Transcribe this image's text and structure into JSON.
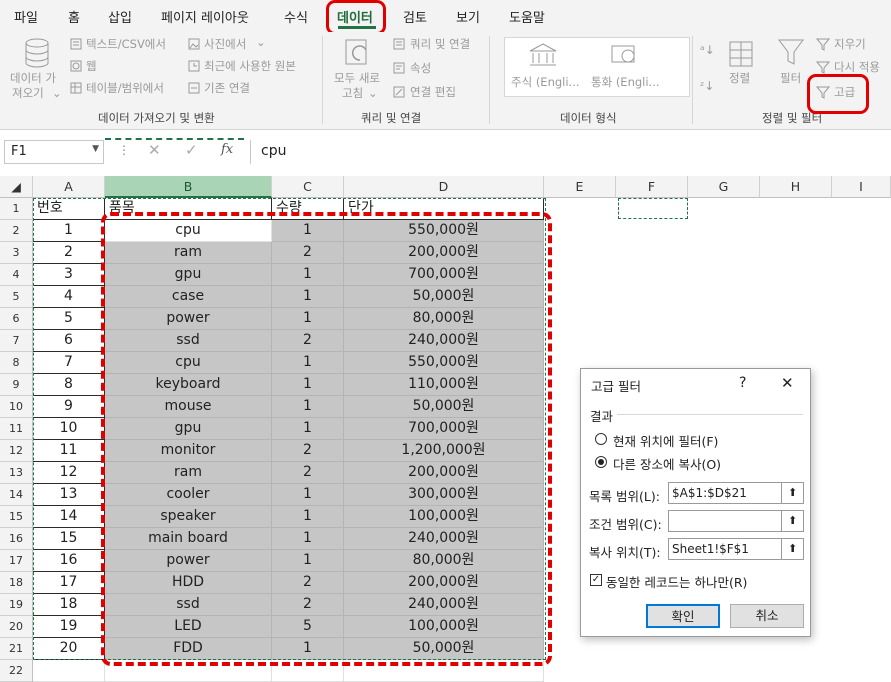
{
  "tabs": [
    "파일",
    "홈",
    "삽입",
    "페이지 레이아웃",
    "수식",
    "데이터",
    "검토",
    "보기",
    "도움말"
  ],
  "ribbon": {
    "get_data": [
      "데이터 가",
      "져오기"
    ],
    "text_csv": "텍스트/CSV에서",
    "web": "웹",
    "table_range": "테이블/범위에서",
    "from_picture": "사진에서",
    "recent_sources": "최근에 사용한 원본",
    "existing_conn": "기존 연결",
    "group_get": "데이터 가져오기 및 변환",
    "refresh_all": [
      "모두 새로",
      "고침"
    ],
    "queries_conn": "쿼리 및 연결",
    "properties": "속성",
    "edit_links": "연결 편집",
    "group_queries": "쿼리 및 연결",
    "stocks": "주식 (Engli...",
    "currencies": "통화 (Engli...",
    "group_types": "데이터 형식",
    "sort": "정렬",
    "filter": "필터",
    "clear": "지우기",
    "reapply": "다시 적용",
    "advanced": "고급",
    "group_sort": "정렬 및 필터"
  },
  "formula_bar": {
    "name_box": "F1",
    "formula": "cpu",
    "fx": "fx"
  },
  "columns": [
    "A",
    "B",
    "C",
    "D",
    "E",
    "F",
    "G",
    "H",
    "I"
  ],
  "headers": {
    "a": "번호",
    "b": "품목",
    "c": "수량",
    "d": "단가"
  },
  "rows": [
    {
      "n": "1",
      "item": "cpu",
      "qty": "1",
      "price": "550,000원"
    },
    {
      "n": "2",
      "item": "ram",
      "qty": "2",
      "price": "200,000원"
    },
    {
      "n": "3",
      "item": "gpu",
      "qty": "1",
      "price": "700,000원"
    },
    {
      "n": "4",
      "item": "case",
      "qty": "1",
      "price": "50,000원"
    },
    {
      "n": "5",
      "item": "power",
      "qty": "1",
      "price": "80,000원"
    },
    {
      "n": "6",
      "item": "ssd",
      "qty": "2",
      "price": "240,000원"
    },
    {
      "n": "7",
      "item": "cpu",
      "qty": "1",
      "price": "550,000원"
    },
    {
      "n": "8",
      "item": "keyboard",
      "qty": "1",
      "price": "110,000원"
    },
    {
      "n": "9",
      "item": "mouse",
      "qty": "1",
      "price": "50,000원"
    },
    {
      "n": "10",
      "item": "gpu",
      "qty": "1",
      "price": "700,000원"
    },
    {
      "n": "11",
      "item": "monitor",
      "qty": "2",
      "price": "1,200,000원"
    },
    {
      "n": "12",
      "item": "ram",
      "qty": "2",
      "price": "200,000원"
    },
    {
      "n": "13",
      "item": "cooler",
      "qty": "1",
      "price": "300,000원"
    },
    {
      "n": "14",
      "item": "speaker",
      "qty": "1",
      "price": "100,000원"
    },
    {
      "n": "15",
      "item": "main board",
      "qty": "1",
      "price": "240,000원"
    },
    {
      "n": "16",
      "item": "power",
      "qty": "1",
      "price": "80,000원"
    },
    {
      "n": "17",
      "item": "HDD",
      "qty": "2",
      "price": "200,000원"
    },
    {
      "n": "18",
      "item": "ssd",
      "qty": "2",
      "price": "240,000원"
    },
    {
      "n": "19",
      "item": "LED",
      "qty": "5",
      "price": "100,000원"
    },
    {
      "n": "20",
      "item": "FDD",
      "qty": "1",
      "price": "50,000원"
    }
  ],
  "row_numbers": [
    "1",
    "2",
    "3",
    "4",
    "5",
    "6",
    "7",
    "8",
    "9",
    "10",
    "11",
    "12",
    "13",
    "14",
    "15",
    "16",
    "17",
    "18",
    "19",
    "20",
    "21",
    "22"
  ],
  "dialog": {
    "title": "고급 필터",
    "help": "?",
    "close": "✕",
    "section": "결과",
    "opt_inplace": "현재 위치에 필터(F)",
    "opt_copy": "다른 장소에 복사(O)",
    "list_range_label": "목록 범위(L):",
    "list_range_value": "$A$1:$D$21",
    "criteria_label": "조건 범위(C):",
    "criteria_value": "",
    "copy_to_label": "복사 위치(T):",
    "copy_to_value": "Sheet1!$F$1",
    "unique_label": "동일한 레코드는 하나만(R)",
    "ok": "확인",
    "cancel": "취소"
  },
  "colors": {
    "accent": "#217346",
    "highlight": "#e00000",
    "selection": "#c6c6c6"
  }
}
